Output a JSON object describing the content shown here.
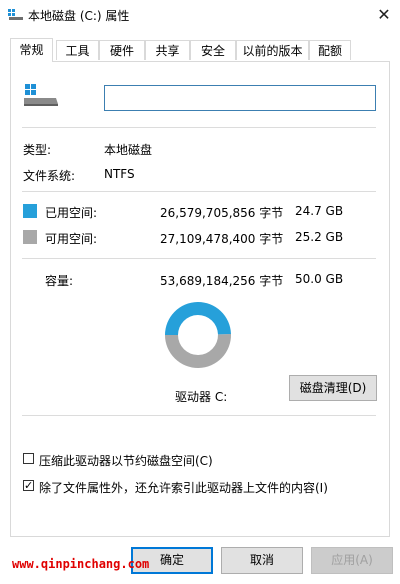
{
  "window": {
    "title": "本地磁盘 (C:) 属性",
    "close_glyph": "✕"
  },
  "tabs": [
    {
      "label": "常规",
      "active": true
    },
    {
      "label": "工具",
      "active": false
    },
    {
      "label": "硬件",
      "active": false
    },
    {
      "label": "共享",
      "active": false
    },
    {
      "label": "安全",
      "active": false
    },
    {
      "label": "以前的版本",
      "active": false
    },
    {
      "label": "配额",
      "active": false
    }
  ],
  "drive_name_input": {
    "value": ""
  },
  "info": {
    "type_label": "类型:",
    "type_value": "本地磁盘",
    "fs_label": "文件系统:",
    "fs_value": "NTFS"
  },
  "space": {
    "used_label": "已用空间:",
    "used_bytes": "26,579,705,856 字节",
    "used_size": "24.7 GB",
    "free_label": "可用空间:",
    "free_bytes": "27,109,478,400 字节",
    "free_size": "25.2 GB",
    "capacity_label": "容量:",
    "capacity_bytes": "53,689,184,256 字节",
    "capacity_size": "50.0 GB",
    "used_fraction": 0.495,
    "used_color": "#26a0da",
    "free_color": "#a8a8a8"
  },
  "drive_label": "驱动器 C:",
  "cleanup_button": "磁盘清理(D)",
  "options": [
    {
      "label": "压缩此驱动器以节约磁盘空间(C)",
      "checked": false
    },
    {
      "label": "除了文件属性外，还允许索引此驱动器上文件的内容(I)",
      "checked": true
    }
  ],
  "buttons": {
    "ok": "确定",
    "cancel": "取消",
    "apply": "应用(A)"
  },
  "watermark": "www.qinpinchang.com",
  "icons": {
    "title": "drive-icon",
    "drive": "drive-icon",
    "close": "close-icon"
  }
}
